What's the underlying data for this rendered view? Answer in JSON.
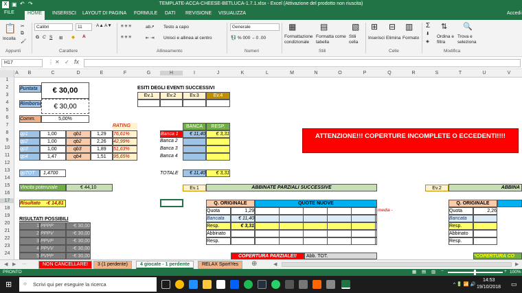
{
  "window": {
    "title": "TEMPLATE-ACCA-CHEESE-BETLUCA-1.7.1.xlsx - Excel (Attivazione del prodotto non riuscita)"
  },
  "ribbon_tabs": [
    "FILE",
    "HOME",
    "INSERISCI",
    "LAYOUT DI PAGINA",
    "FORMULE",
    "DATI",
    "REVISIONE",
    "VISUALIZZA"
  ],
  "account": "Accedi",
  "clipboard": {
    "paste": "Incolla",
    "group": "Appunti"
  },
  "font": {
    "name": "Calibri",
    "size": "11",
    "group": "Carattere"
  },
  "align": {
    "wrap": "Testo a capo",
    "merge": "Unisci e allinea al centro",
    "group": "Allineamento"
  },
  "number": {
    "format": "Generale",
    "group": "Numeri"
  },
  "styles": {
    "cond": "Formattazione condizionale",
    "table": "Formatta come tabella",
    "cell": "Stili cella",
    "group": "Stili"
  },
  "cells": {
    "insert": "Inserisci",
    "delete": "Elimina",
    "format": "Formato",
    "group": "Celle"
  },
  "edit": {
    "sort": "Ordina e filtra",
    "find": "Trova e seleziona",
    "group": "Modifica"
  },
  "namebox": "H17",
  "fx": "fx",
  "columns": [
    "A",
    "B",
    "C",
    "D",
    "E",
    "F",
    "G",
    "H",
    "I",
    "J",
    "K",
    "L",
    "M",
    "N",
    "O",
    "P",
    "Q",
    "R",
    "S",
    "T",
    "U",
    "V"
  ],
  "rows": [
    "1",
    "2",
    "3",
    "4",
    "5",
    "6",
    "7",
    "8",
    "9",
    "10",
    "11",
    "12",
    "13",
    "14",
    "15",
    "16",
    "17",
    "18",
    "19",
    "20",
    "21",
    "22",
    "23",
    "24"
  ],
  "sheet": {
    "puntata_lbl": "Puntata",
    "puntata": "€ 30,00",
    "rimborso_lbl": "Rimborso",
    "rimborso": "€ 30,00",
    "comm_lbl": "Comm.",
    "comm": "5,00%",
    "esiti": "ESITI DEGLI EVENTI SUCCESSIVI",
    "ev": [
      "Ev.1",
      "Ev.2",
      "Ev.3",
      "Ev.4"
    ],
    "rating": "RATING",
    "qp": [
      "qp1",
      "qp2",
      "qp3",
      "qp4"
    ],
    "qpv": [
      "1,00",
      "1,00",
      "1,00",
      "1,47"
    ],
    "qb": [
      "qb1",
      "qb2",
      "qb3",
      "qb4"
    ],
    "qbv": [
      "1,29",
      "2,26",
      "1,89",
      "1,51"
    ],
    "ratings": [
      "76,61%",
      "42,99%",
      "51,63%",
      "95,65%"
    ],
    "banca_h": "BANCA",
    "resp_h": "RESP.",
    "banche": [
      "Banca 1",
      "Banca 2",
      "Banca 3",
      "Banca 4"
    ],
    "banca1": "€ 11,40",
    "resp1": "€ 3,31",
    "qptot_lbl": "qpTOT",
    "qptot": "1,4700",
    "totale_lbl": "TOTALE",
    "tot_banca": "€ 11,40",
    "tot_resp": "€ 3,31",
    "alert": "ATTENZIONE!!! COPERTURE INCOMPLETE O ECCEDENTI!!!!",
    "vincita_lbl": "Vincita potenziale",
    "vincita": "€ 44,10",
    "risultato_lbl": "Risultato",
    "risultato": "-€ 14,81",
    "risultati": "RISULTATI POSSIBILI",
    "res_codes": [
      "PPPP",
      "PPPV",
      "PPVP",
      "PPVV",
      "PVPP",
      "PVPV",
      "PVVP"
    ],
    "res_val": "-€ 30,00",
    "ev1": "Ev.1",
    "abbinate": "ABBINATE PARZIALI SUCCESSIVE",
    "q_orig": "Q. ORIGINALE",
    "quote_nuove": "QUOTE NUOVE",
    "media": "media -",
    "rlabels": [
      "Quota",
      "Bancata",
      "Resp.",
      "Abbinato",
      "Resp."
    ],
    "quota": "1,29",
    "bancata": "€ 11,40",
    "respv": "€ 3,31",
    "copertura": "COPERTURA PARZIALE!!",
    "abb_tot": "Abb. TOT.",
    "ev2": "Ev.2",
    "abbina_cut": "ABBINA",
    "quota2": "2,26",
    "copertura2": "*COPERTURA CO"
  },
  "sheet_tabs": [
    "NON CANCELLARE!",
    "3 (1 perdente)",
    "4 giocate - 1 perdente",
    "RELAX SportYes"
  ],
  "status": {
    "ready": "PRONTO",
    "zoom": "100%"
  },
  "taskbar": {
    "search": "Scrivi qui per eseguire la ricerca",
    "time": "14:53",
    "date": "19/10/2018"
  }
}
